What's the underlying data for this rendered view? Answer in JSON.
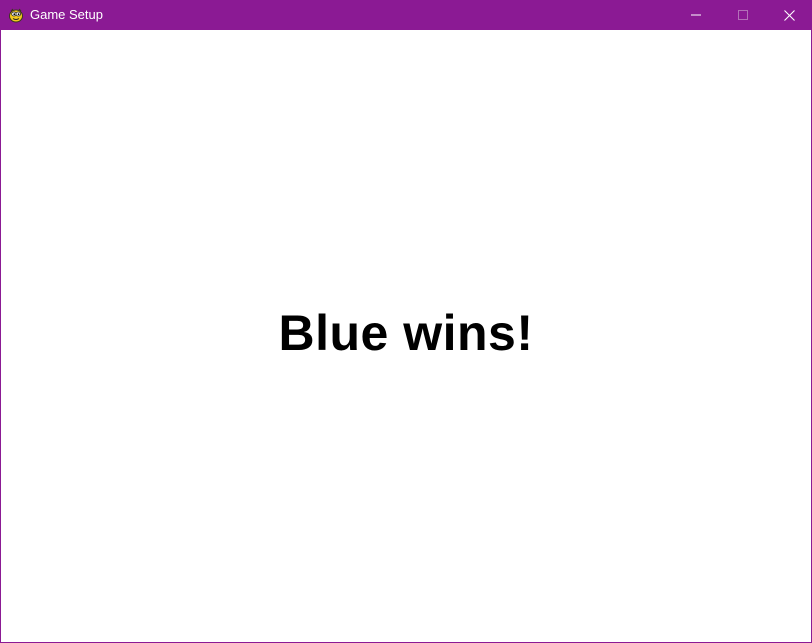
{
  "window": {
    "title": "Game Setup",
    "app_icon": "pygame-snake-icon",
    "titlebar_color": "#8b1a94",
    "controls": {
      "minimize_icon": "minimize-icon",
      "maximize_icon": "maximize-icon",
      "close_icon": "close-icon"
    }
  },
  "game": {
    "result_message": "Blue wins!",
    "text_color": "#000000",
    "background_color": "#ffffff"
  }
}
